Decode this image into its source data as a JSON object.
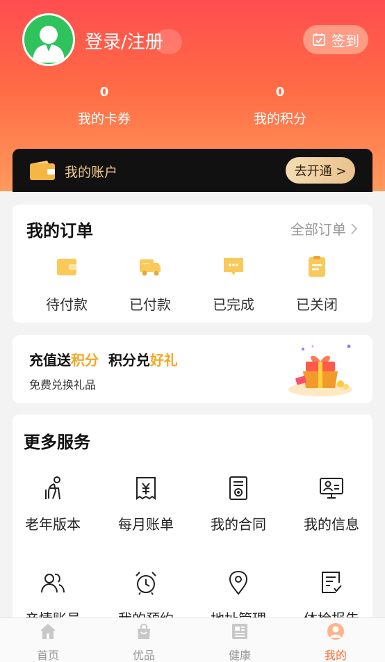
{
  "header": {
    "login_label": "登录/注册",
    "signin_label": "签到",
    "stats": [
      {
        "value": "0",
        "label": "我的卡券"
      },
      {
        "value": "0",
        "label": "我的积分"
      }
    ],
    "account_label": "我的账户",
    "open_label": "去开通 >"
  },
  "orders": {
    "title": "我的订单",
    "all_label": "全部订单",
    "items": [
      {
        "label": "待付款",
        "icon": "wallet-icon"
      },
      {
        "label": "已付款",
        "icon": "delivery-truck-icon"
      },
      {
        "label": "已完成",
        "icon": "chat-bubble-icon"
      },
      {
        "label": "已关闭",
        "icon": "clipboard-icon"
      }
    ]
  },
  "promo": {
    "title_part1": "充值送",
    "title_part2": "积分",
    "title_part3": "积分兑",
    "title_part4": "好礼",
    "subtitle": "免费兑换礼品"
  },
  "services": {
    "title": "更多服务",
    "items": [
      {
        "label": "老年版本",
        "icon": "elderly-person-icon"
      },
      {
        "label": "每月账单",
        "icon": "bill-icon"
      },
      {
        "label": "我的合同",
        "icon": "contract-icon"
      },
      {
        "label": "我的信息",
        "icon": "profile-info-icon"
      },
      {
        "label": "亲情账号",
        "icon": "family-users-icon"
      },
      {
        "label": "我的预约",
        "icon": "alarm-clock-icon"
      },
      {
        "label": "地址管理",
        "icon": "location-pin-icon"
      },
      {
        "label": "体检报告",
        "icon": "report-icon"
      }
    ]
  },
  "tabbar": {
    "items": [
      {
        "label": "首页",
        "icon": "home-icon"
      },
      {
        "label": "优品",
        "icon": "shopping-bag-icon"
      },
      {
        "label": "健康",
        "icon": "news-icon"
      },
      {
        "label": "我的",
        "icon": "user-icon"
      }
    ],
    "active_color": "#ff6a2f",
    "inactive_color": "#999999"
  },
  "colors": {
    "hero_top": "#ff4d50",
    "hero_bottom": "#ff9a5c",
    "order_icon": "#f9c95a",
    "highlight_yellow": "#f5a623"
  }
}
